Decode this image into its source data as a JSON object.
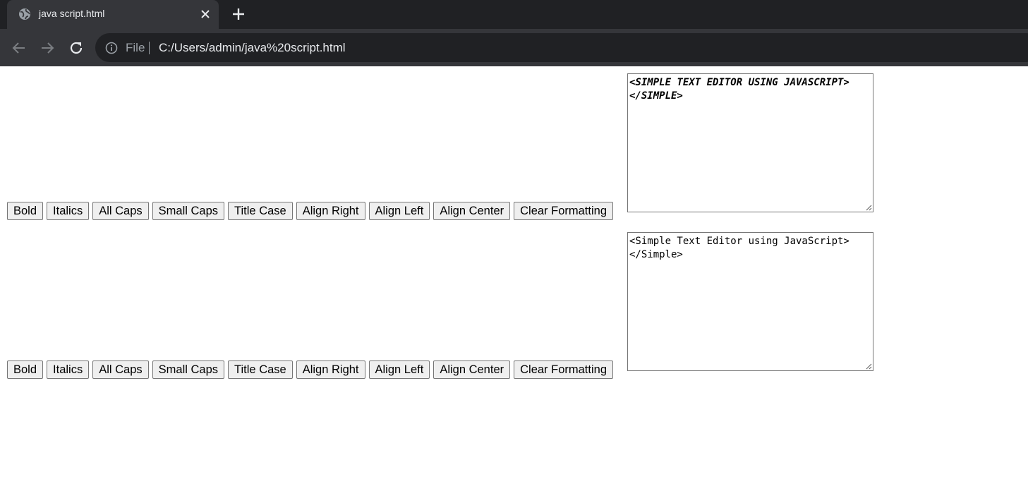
{
  "browser": {
    "tab_title": "java script.html",
    "address_scheme_label": "File",
    "url": "C:/Users/admin/java%20script.html"
  },
  "editors": [
    {
      "buttons": [
        "Bold",
        "Italics",
        "All Caps",
        "Small Caps",
        "Title Case",
        "Align Right",
        "Align Left",
        "Align Center",
        "Clear Formatting"
      ],
      "text": "<SIMPLE TEXT EDITOR USING JAVASCRIPT>\n</SIMPLE>"
    },
    {
      "buttons": [
        "Bold",
        "Italics",
        "All Caps",
        "Small Caps",
        "Title Case",
        "Align Right",
        "Align Left",
        "Align Center",
        "Clear Formatting"
      ],
      "text": "<Simple Text Editor using JavaScript>\n</Simple>"
    }
  ],
  "icons": {
    "tab_favicon": "globe-icon",
    "tab_close": "close-icon",
    "new_tab": "plus-icon",
    "back": "back-arrow-icon",
    "forward": "forward-arrow-icon",
    "reload": "reload-icon",
    "site_info": "info-icon"
  },
  "colors": {
    "tabstrip_bg": "#202124",
    "toolbar_bg": "#35363a",
    "button_bg": "#efefef"
  }
}
